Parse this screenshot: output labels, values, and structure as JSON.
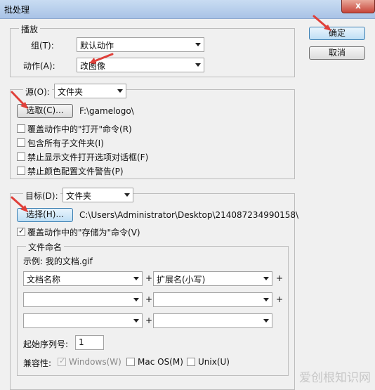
{
  "window": {
    "title": "批处理",
    "close_glyph": "x"
  },
  "buttons": {
    "ok": "确定",
    "cancel": "取消"
  },
  "play": {
    "legend": "播放",
    "set_label": "组(T):",
    "set_value": "默认动作",
    "action_label": "动作(A):",
    "action_value": "改图像"
  },
  "source": {
    "label": "源(O):",
    "value": "文件夹",
    "choose_button": "选取(C)...",
    "path": "F:\\gamelogo\\",
    "options": [
      {
        "label": "覆盖动作中的\"打开\"命令(R)",
        "checked": false
      },
      {
        "label": "包含所有子文件夹(I)",
        "checked": false
      },
      {
        "label": "禁止显示文件打开选项对话框(F)",
        "checked": false
      },
      {
        "label": "禁止颜色配置文件警告(P)",
        "checked": false
      }
    ]
  },
  "destination": {
    "label": "目标(D):",
    "value": "文件夹",
    "choose_button": "选择(H)...",
    "path": "C:\\Users\\Administrator\\Desktop\\214087234990158\\",
    "override_label": "覆盖动作中的\"存储为\"命令(V)",
    "override_checked": true
  },
  "naming": {
    "legend": "文件命名",
    "example": "示例: 我的文档.gif",
    "plus": "+",
    "row1_left": "文档名称",
    "row1_right": "扩展名(小写)",
    "row2_left": "",
    "row2_right": "",
    "row3_left": "",
    "row3_right": "",
    "serial_label": "起始序列号:",
    "serial_value": "1",
    "compat_label": "兼容性:",
    "compat": [
      {
        "label": "Windows(W)",
        "checked": true,
        "disabled": true
      },
      {
        "label": "Mac OS(M)",
        "checked": false,
        "disabled": false
      },
      {
        "label": "Unix(U)",
        "checked": false,
        "disabled": false
      }
    ]
  },
  "watermark": "爱创根知识网",
  "colors": {
    "annotation_arrow": "#e0403a"
  }
}
